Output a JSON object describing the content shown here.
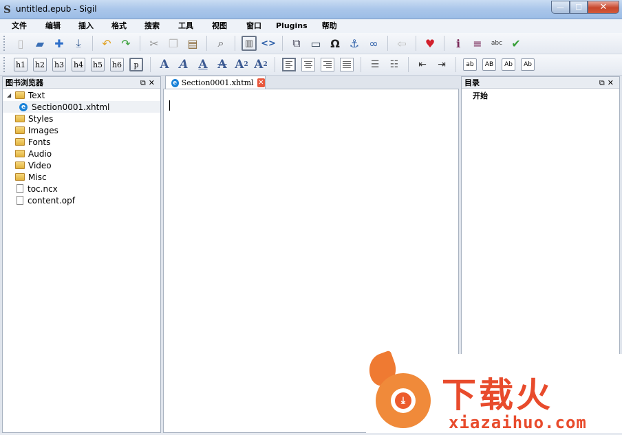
{
  "window": {
    "title": "untitled.epub - Sigil",
    "app_icon": "S"
  },
  "menu": [
    "文件",
    "编辑",
    "插入",
    "格式",
    "搜索",
    "工具",
    "视图",
    "窗口",
    "Plugins",
    "帮助"
  ],
  "toolbar2": {
    "headings": [
      "h1",
      "h2",
      "h3",
      "h4",
      "h5",
      "h6",
      "p"
    ],
    "case_buttons": [
      "ab",
      "AB",
      "Ab",
      "Ab"
    ]
  },
  "book_browser": {
    "title": "图书浏览器",
    "items": [
      {
        "label": "Text",
        "type": "folder"
      },
      {
        "label": "Section0001.xhtml",
        "type": "xhtml"
      },
      {
        "label": "Styles",
        "type": "folder"
      },
      {
        "label": "Images",
        "type": "folder"
      },
      {
        "label": "Fonts",
        "type": "folder"
      },
      {
        "label": "Audio",
        "type": "folder"
      },
      {
        "label": "Video",
        "type": "folder"
      },
      {
        "label": "Misc",
        "type": "folder"
      },
      {
        "label": "toc.ncx",
        "type": "file"
      },
      {
        "label": "content.opf",
        "type": "file"
      }
    ]
  },
  "editor": {
    "tab_label": "Section0001.xhtml"
  },
  "toc": {
    "title": "目录",
    "items": [
      "开始"
    ]
  },
  "watermark": {
    "cn": "下载火",
    "en": "xiazaihuo.com"
  },
  "colors": {
    "accent": "#e84b2c",
    "titlebar": "#aac6ea"
  }
}
